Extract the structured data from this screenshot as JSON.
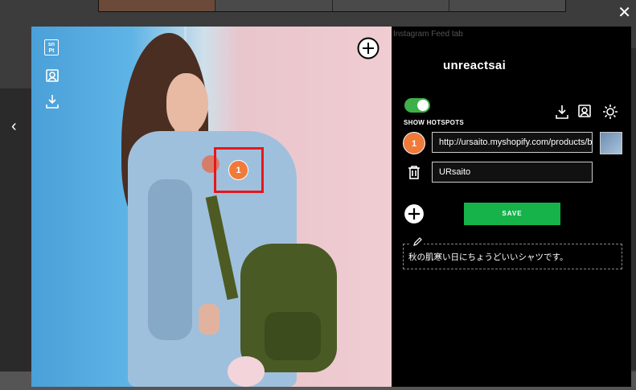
{
  "background": {
    "tab_labels": [
      "",
      "",
      "",
      ""
    ],
    "partial_text": "Instagram Feed tab"
  },
  "modal": {
    "close_icon": "close-icon",
    "prev_icon": "chevron-left-icon",
    "photo": {
      "logo_text": "sn\nPt",
      "hotspots": [
        {
          "number": "1"
        }
      ]
    },
    "panel": {
      "username": "unreactsai",
      "show_hotspots_label": "SHOW HOTSPOTS",
      "show_hotspots_on": true,
      "hotspot": {
        "number": "1",
        "url": "http://ursaito.myshopify.com/products/blu",
        "label": "URsaito"
      },
      "save_label": "SAVE",
      "caption": "秋の肌寒い日にちょうどいいシャツです。"
    }
  },
  "colors": {
    "accent_green": "#16b34a",
    "toggle_green": "#3db049",
    "hotspot_orange": "#f07a3a",
    "highlight_red": "#e8161c"
  }
}
